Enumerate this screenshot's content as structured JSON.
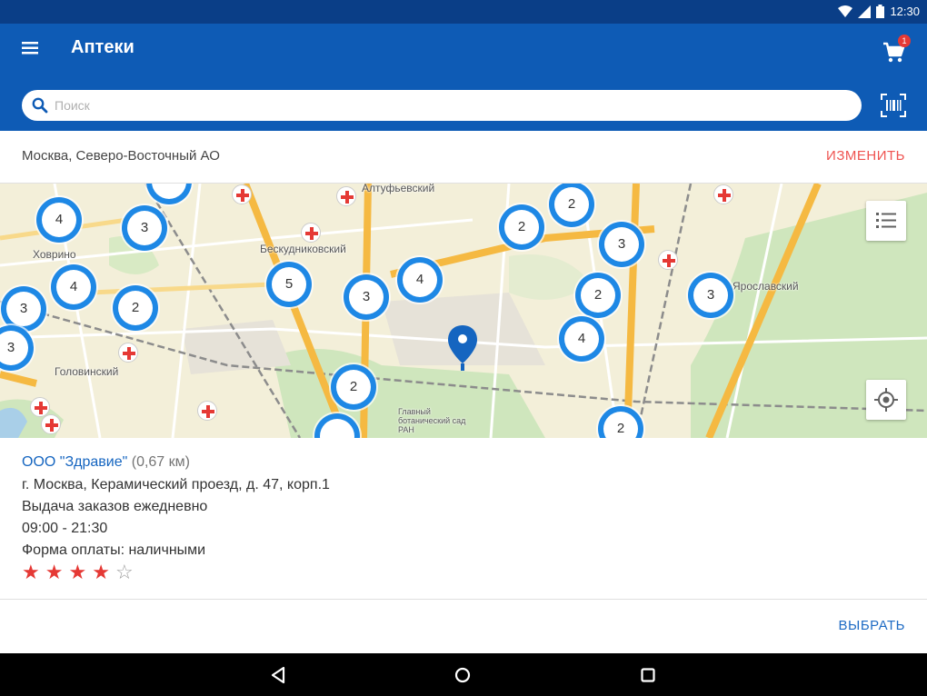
{
  "status_bar": {
    "time": "12:30"
  },
  "app_bar": {
    "title": "Аптеки",
    "cart_badge": "1"
  },
  "search": {
    "placeholder": "Поиск"
  },
  "location": {
    "region": "Москва, Северо-Восточный АО",
    "change_label": "ИЗМЕНИТЬ"
  },
  "map": {
    "labels": [
      {
        "text": "Алтуфьевский"
      },
      {
        "text": "Бескудниковский"
      },
      {
        "text": "Ховрино"
      },
      {
        "text": "Головинский"
      },
      {
        "text": "Ярославский"
      },
      {
        "text": "Главный ботанический сад РАН"
      }
    ],
    "clusters": [
      "4",
      "3",
      "4",
      "2",
      "3",
      "3",
      "5",
      "3",
      "4",
      "2",
      "2",
      "2",
      "3",
      "2",
      "4",
      "3",
      "2"
    ]
  },
  "pharmacy": {
    "name": "ООО \"Здравие\"",
    "distance": "(0,67 км)",
    "address": "г. Москва, Керамический проезд, д. 47, корп.1",
    "delivery": "Выдача заказов ежедневно",
    "hours": "09:00 - 21:30",
    "payment": "Форма оплаты: наличными",
    "rating": 4,
    "rating_max": 5
  },
  "action": {
    "select_label": "ВЫБРАТЬ"
  },
  "colors": {
    "primary": "#0e5bb5",
    "status_bar": "#0a3e87",
    "accent": "#ef5350",
    "link": "#1565c0",
    "star": "#e53935"
  }
}
